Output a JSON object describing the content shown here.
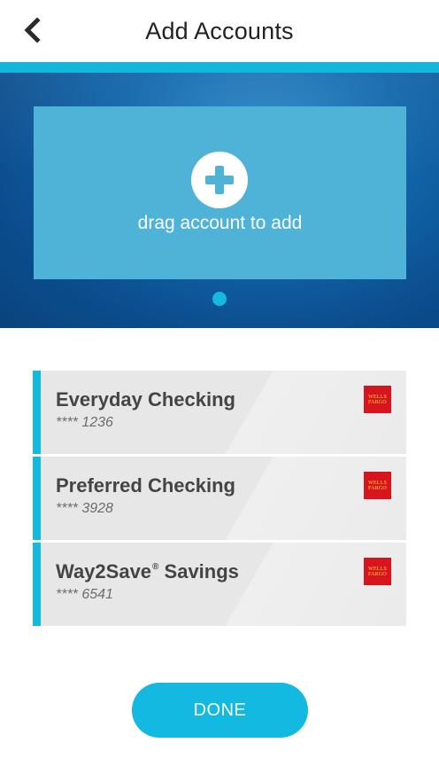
{
  "header": {
    "title": "Add Accounts",
    "back_icon": "chevron-left-icon"
  },
  "drop_zone": {
    "icon": "plus-circle-icon",
    "label": "drag account to add"
  },
  "carousel": {
    "pages": 1,
    "active_page": 1
  },
  "accounts": [
    {
      "name": "Everyday Checking",
      "registered": "",
      "name_suffix": "",
      "number": "**** 1236",
      "bank_logo": "WELLS FARGO"
    },
    {
      "name": "Preferred Checking",
      "registered": "",
      "name_suffix": "",
      "number": "**** 3928",
      "bank_logo": "WELLS FARGO"
    },
    {
      "name": "Way2Save",
      "registered": "®",
      "name_suffix": " Savings",
      "number": "**** 6541",
      "bank_logo": "WELLS FARGO"
    }
  ],
  "done_button": {
    "label": "DONE"
  },
  "colors": {
    "accent": "#13b9e1",
    "drop_zone": "#4fb2d7",
    "hero_dark": "#0b4c8c",
    "card_bg": "#e7e7e7",
    "logo_red": "#d8141f",
    "logo_yellow": "#f5d53b"
  }
}
